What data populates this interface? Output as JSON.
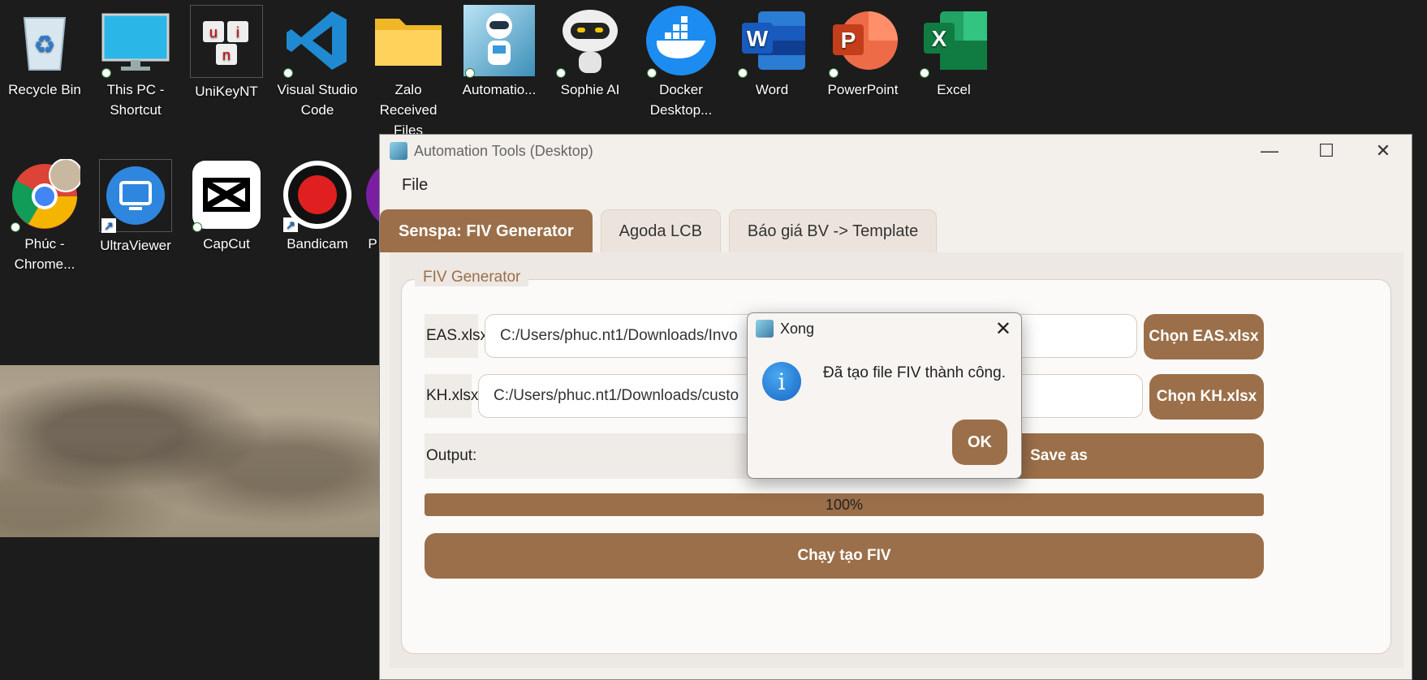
{
  "desktop": {
    "icons_row1": [
      {
        "label": "Recycle Bin",
        "icon": "recycle-bin-icon"
      },
      {
        "label": "This PC - Shortcut",
        "icon": "monitor-icon"
      },
      {
        "label": "UniKeyNT",
        "icon": "unikey-icon"
      },
      {
        "label": "Visual Studio Code",
        "icon": "vscode-icon"
      },
      {
        "label": "Zalo Received Files",
        "icon": "folder-icon"
      },
      {
        "label": "Automatio...",
        "icon": "robot-icon"
      },
      {
        "label": "Sophie AI",
        "icon": "robot-head-icon"
      },
      {
        "label": "Docker Desktop...",
        "icon": "docker-icon"
      },
      {
        "label": "Word",
        "icon": "word-icon"
      },
      {
        "label": "PowerPoint",
        "icon": "powerpoint-icon"
      },
      {
        "label": "Excel",
        "icon": "excel-icon"
      }
    ],
    "icons_row2": [
      {
        "label": "Phúc - Chrome...",
        "icon": "chrome-icon"
      },
      {
        "label": "UltraViewer",
        "icon": "ultraviewer-icon"
      },
      {
        "label": "CapCut",
        "icon": "capcut-icon"
      },
      {
        "label": "Bandicam",
        "icon": "bandicam-icon"
      },
      {
        "label": "P",
        "icon": "app-icon"
      }
    ]
  },
  "window": {
    "title": "Automation Tools (Desktop)",
    "controls": {
      "minimize": "—",
      "maximize": "☐",
      "close": "✕"
    },
    "menu": [
      "File"
    ],
    "tabs": [
      {
        "label": "Senspa: FIV Generator",
        "active": true
      },
      {
        "label": "Agoda LCB",
        "active": false
      },
      {
        "label": "Báo giá BV -> Template",
        "active": false
      }
    ],
    "group_title": "FIV Generator",
    "eas": {
      "label": "EAS.xlsx:",
      "value": "C:/Users/phuc.nt1/Downloads/Invo",
      "button": "Chọn EAS.xlsx"
    },
    "kh": {
      "label": "KH.xlsx:",
      "value": "C:/Users/phuc.nt1/Downloads/custo",
      "button": "Chọn KH.xlsx"
    },
    "output": {
      "label": "Output:",
      "button": "Save as"
    },
    "progress": {
      "value": 100,
      "text": "100%"
    },
    "run_button": "Chạy tạo FIV"
  },
  "dialog": {
    "title": "Xong",
    "message": "Đã tạo file FIV thành công.",
    "ok": "OK",
    "close": "✕",
    "icon_glyph": "i"
  }
}
